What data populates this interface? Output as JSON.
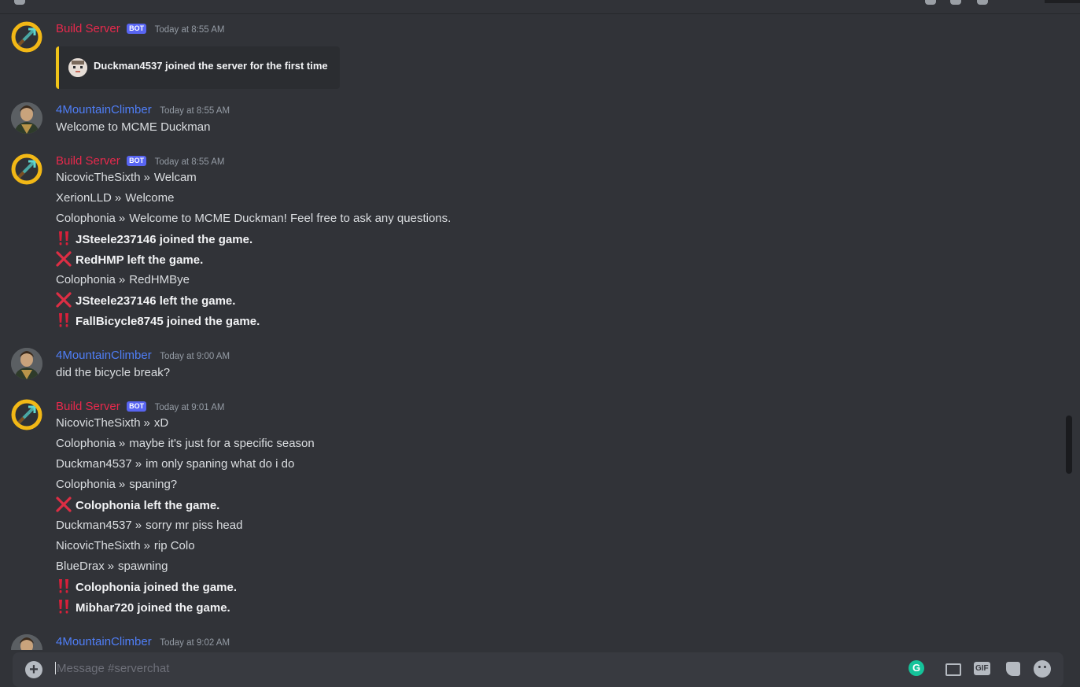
{
  "composer": {
    "placeholder": "Message #serverchat"
  },
  "messages": [
    {
      "author": "Build Server",
      "bot_badge": "BOT",
      "timestamp": "Today at 8:55 AM",
      "embed_text": "Duckman4537 joined the server for the first time"
    },
    {
      "author": "4MountainClimber",
      "timestamp": "Today at 8:55 AM",
      "text": "Welcome to MCME Duckman"
    },
    {
      "author": "Build Server",
      "bot_badge": "BOT",
      "timestamp": "Today at 8:55 AM",
      "lines": [
        {
          "user": "NicovicTheSixth",
          "sep": "»",
          "text": "Welcam"
        },
        {
          "user": "XerionLLD",
          "sep": "»",
          "text": "Welcome"
        },
        {
          "user": "Colophonia",
          "sep": "»",
          "text": "Welcome to MCME Duckman! Feel free to ask any questions."
        },
        {
          "event": "join",
          "text": "JSteele237146 joined the game."
        },
        {
          "event": "leave",
          "text": "RedHMP left the game."
        },
        {
          "user": "Colophonia",
          "sep": "»",
          "text": "RedHMBye"
        },
        {
          "event": "leave",
          "text": "JSteele237146 left the game."
        },
        {
          "event": "join",
          "text": "FallBicycle8745 joined the game."
        }
      ]
    },
    {
      "author": "4MountainClimber",
      "timestamp": "Today at 9:00 AM",
      "text": "did the bicycle break?"
    },
    {
      "author": "Build Server",
      "bot_badge": "BOT",
      "timestamp": "Today at 9:01 AM",
      "lines": [
        {
          "user": "NicovicTheSixth",
          "sep": "»",
          "text": "xD"
        },
        {
          "user": "Colophonia",
          "sep": "»",
          "text": "maybe it's just for a specific season"
        },
        {
          "user": "Duckman4537",
          "sep": "»",
          "text": "im only spaning what do i do"
        },
        {
          "user": "Colophonia",
          "sep": "»",
          "text": "spaning?"
        },
        {
          "event": "leave",
          "text": "Colophonia left the game."
        },
        {
          "user": "Duckman4537",
          "sep": "»",
          "text": "sorry mr piss head"
        },
        {
          "user": "NicovicTheSixth",
          "sep": "»",
          "text": "rip Colo"
        },
        {
          "user": "BlueDrax",
          "sep": "»",
          "text": "spawning"
        },
        {
          "event": "join",
          "text": "Colophonia joined the game."
        },
        {
          "event": "join",
          "text": "Mibhar720 joined the game."
        }
      ]
    },
    {
      "author": "4MountainClimber",
      "timestamp": "Today at 9:02 AM"
    }
  ],
  "icons": {
    "join": "double-exclamation-icon",
    "leave": "red-x-icon",
    "bot_avatar": "diamond-pickaxe-icon",
    "user_avatar": "portrait-avatar",
    "composer": [
      "add-attachment-icon",
      "grammarly-icon",
      "gift-icon",
      "gif-icon",
      "sticker-icon",
      "emoji-icon"
    ]
  },
  "colors": {
    "background": "#313338",
    "bot_name": "#e8294c",
    "user_name": "#4f7ef7",
    "bot_badge": "#5865f2",
    "embed_accent": "#f0c419",
    "join_icon": "#d8203a",
    "leave_icon": "#dd2e44"
  }
}
